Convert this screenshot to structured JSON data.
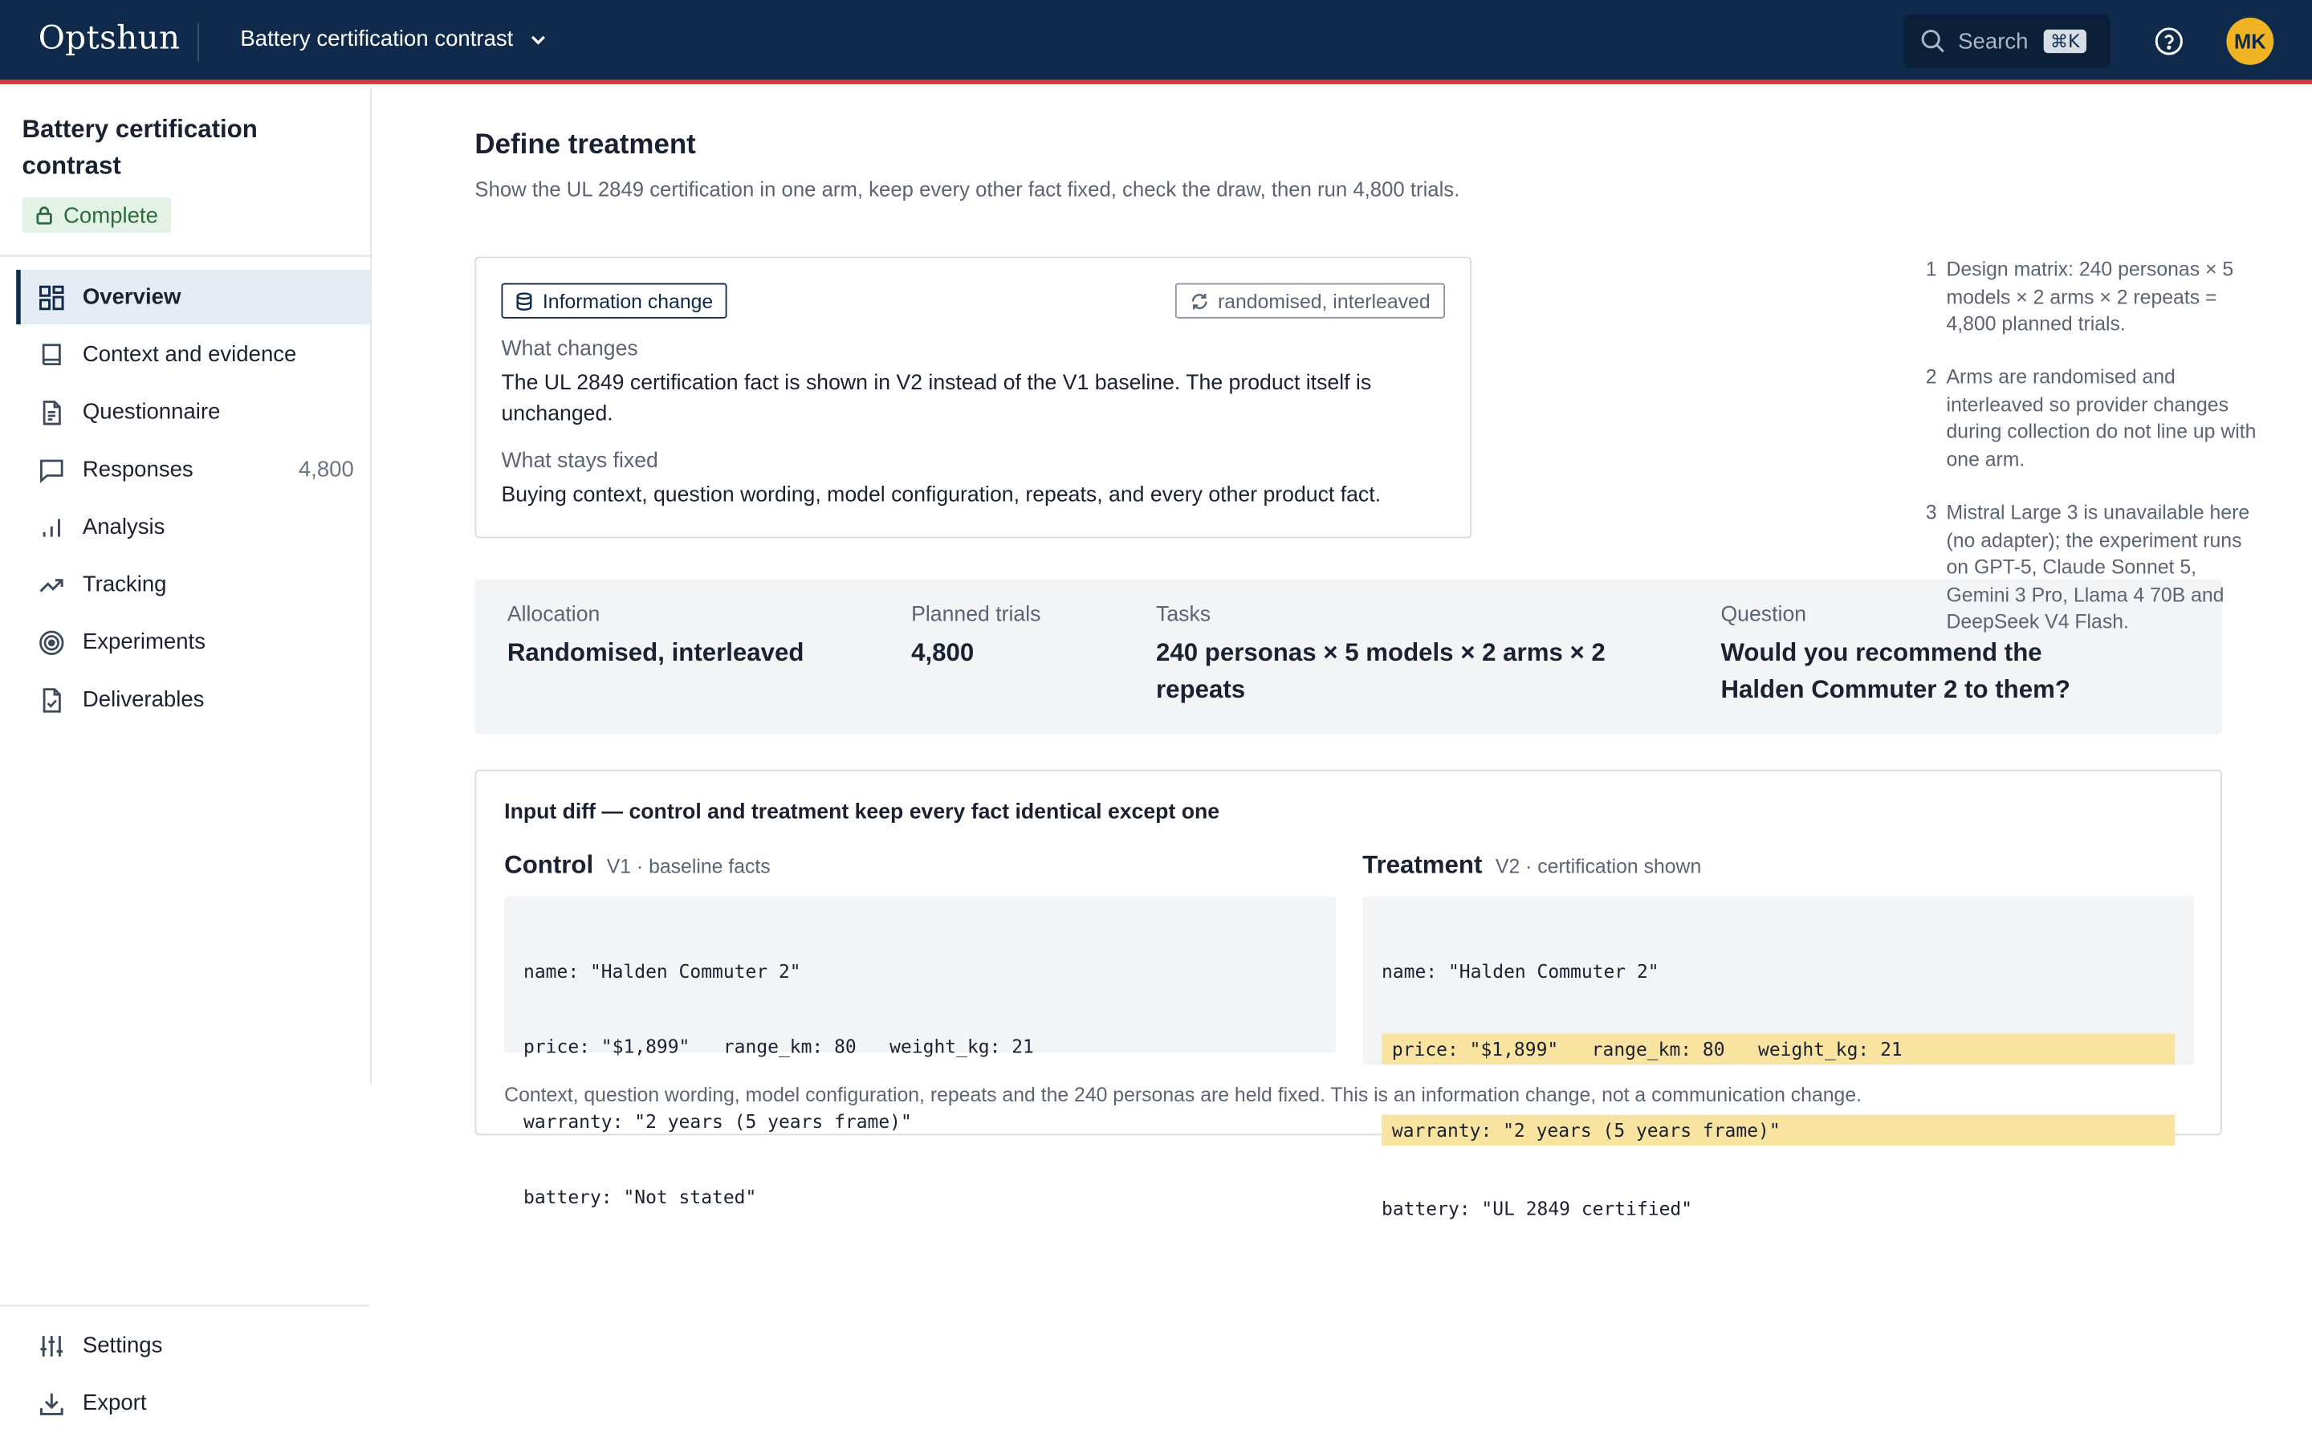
{
  "app": {
    "brand": "Optshun",
    "project_switcher": "Battery certification contrast",
    "search_label": "Search",
    "search_shortcut": "⌘K",
    "user_initials": "MK"
  },
  "sidebar": {
    "project_title": "Battery certification contrast",
    "status": "Complete",
    "items": [
      {
        "label": "Overview",
        "icon": "grid-icon",
        "active": true
      },
      {
        "label": "Context and evidence",
        "icon": "book-icon"
      },
      {
        "label": "Questionnaire",
        "icon": "document-icon"
      },
      {
        "label": "Responses",
        "icon": "chat-icon",
        "count": "4,800"
      },
      {
        "label": "Analysis",
        "icon": "bar-chart-icon"
      },
      {
        "label": "Tracking",
        "icon": "trend-icon"
      },
      {
        "label": "Experiments",
        "icon": "target-icon"
      },
      {
        "label": "Deliverables",
        "icon": "file-check-icon"
      }
    ],
    "footer_items": [
      {
        "label": "Settings",
        "icon": "sliders-icon"
      },
      {
        "label": "Export",
        "icon": "download-icon"
      }
    ]
  },
  "main": {
    "title": "Define treatment",
    "subtitle": "Show the UL 2849 certification in one arm, keep every other fact fixed, check the draw, then run 4,800 trials.",
    "treatment_card": {
      "tag_type": "Information change",
      "tag_allocation": "randomised, interleaved",
      "changes_label": "What changes",
      "changes_text": "The UL 2849 certification fact is shown in V2 instead of the V1 baseline. The product itself is unchanged.",
      "fixed_label": "What stays fixed",
      "fixed_text": "Buying context, question wording, model configuration, repeats, and every other product fact."
    },
    "notes": [
      {
        "num": "1",
        "text": "Design matrix: 240 personas × 5 models × 2 arms × 2 repeats = 4,800 planned trials."
      },
      {
        "num": "2",
        "text": "Arms are randomised and interleaved so provider changes during collection do not line up with one arm."
      },
      {
        "num": "3",
        "text": "Mistral Large 3 is unavailable here (no adapter); the experiment runs on GPT-5, Claude Sonnet 5, Gemini 3 Pro, Llama 4 70B and DeepSeek V4 Flash."
      }
    ],
    "summary": {
      "allocation_label": "Allocation",
      "allocation_value": "Randomised, interleaved",
      "trials_label": "Planned trials",
      "trials_value": "4,800",
      "tasks_label": "Tasks",
      "tasks_value": "240 personas × 5 models × 2 arms × 2 repeats",
      "question_label": "Question",
      "question_value": "Would you recommend the Halden Commuter 2 to them?"
    },
    "diff": {
      "title": "Input diff — control and treatment keep every fact identical except one",
      "control_name": "Control",
      "control_sub": "V1 · baseline facts",
      "control_lines": [
        "name: \"Halden Commuter 2\"",
        "price: \"$1,899\"   range_km: 80   weight_kg: 21",
        "warranty: \"2 years (5 years frame)\"",
        "battery: \"Not stated\""
      ],
      "treatment_name": "Treatment",
      "treatment_sub": "V2 · certification shown",
      "treatment_lines": [
        "name: \"Halden Commuter 2\"",
        "price: \"$1,899\"   range_km: 80   weight_kg: 21",
        "warranty: \"2 years (5 years frame)\"",
        "battery: \"UL 2849 certified\""
      ],
      "footer": "Context, question wording, model configuration, repeats and the 240 personas are held fixed. This is an information change, not a communication change."
    }
  },
  "colors": {
    "topbar": "#102a4c",
    "accent_stripe": "#d13a36",
    "avatar": "#f0b323",
    "status_bg": "#e3f1e6",
    "status_fg": "#2b6b3f",
    "highlight": "#f9e3a0"
  }
}
